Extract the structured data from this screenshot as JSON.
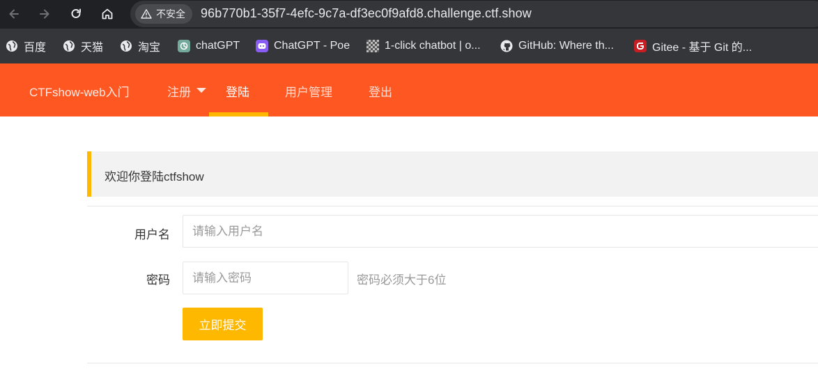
{
  "browser": {
    "security_label": "不安全",
    "url": "96b770b1-35f7-4efc-9c7a-df3ec0f9afd8.challenge.ctf.show",
    "bookmarks": [
      {
        "label": "百度",
        "icon": "globe-icon"
      },
      {
        "label": "天猫",
        "icon": "globe-icon"
      },
      {
        "label": "淘宝",
        "icon": "globe-icon"
      },
      {
        "label": "chatGPT",
        "icon": "openai-icon"
      },
      {
        "label": "ChatGPT - Poe",
        "icon": "poe-icon"
      },
      {
        "label": "1-click chatbot | o...",
        "icon": "checker-icon"
      },
      {
        "label": "GitHub: Where th...",
        "icon": "github-icon"
      },
      {
        "label": "Gitee - 基于 Git 的...",
        "icon": "gitee-icon"
      }
    ]
  },
  "site_nav": {
    "brand": "CTFshow-web入门",
    "items": [
      {
        "label": "注册",
        "has_dropdown": true,
        "active": false
      },
      {
        "label": "登陆",
        "active": true
      },
      {
        "label": "用户管理",
        "active": false
      },
      {
        "label": "登出",
        "active": false
      }
    ]
  },
  "main": {
    "welcome": "欢迎你登陆ctfshow",
    "form": {
      "username_label": "用户名",
      "username_placeholder": "请输入用户名",
      "password_label": "密码",
      "password_placeholder": "请输入密码",
      "password_hint": "密码必须大于6位",
      "submit_label": "立即提交"
    }
  },
  "colors": {
    "chrome_dark": "#202124",
    "bookmarks_bg": "#35363a",
    "nav_bg": "#ff5722",
    "accent_yellow": "#ffb800",
    "welcome_bg": "#f2f2f2"
  }
}
